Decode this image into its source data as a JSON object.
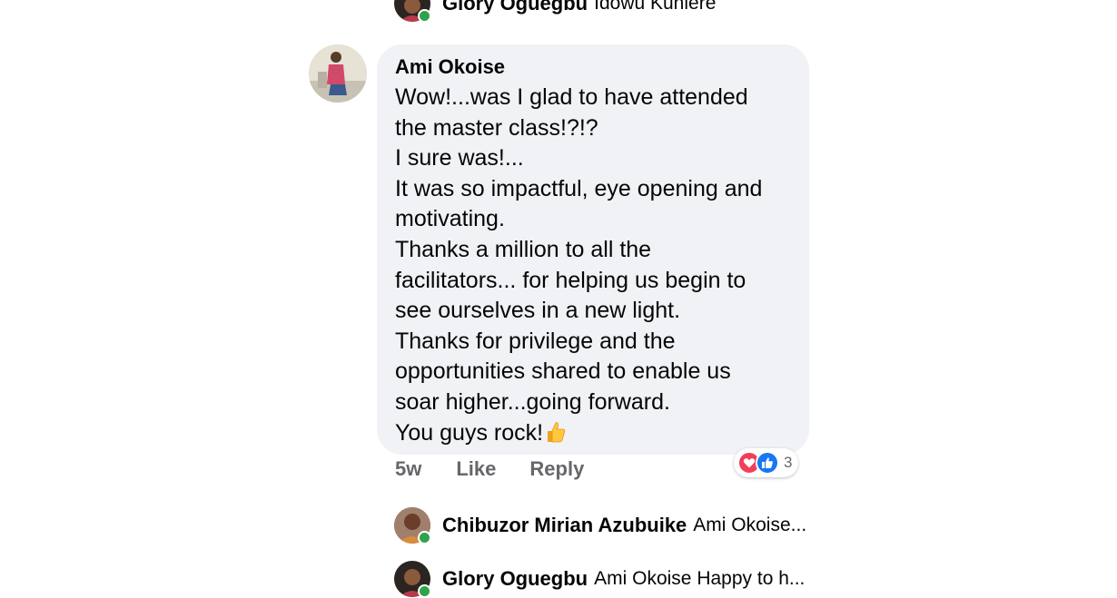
{
  "top_reply": {
    "name": "Glory Oguegbu",
    "text": "Idowu Kuniere"
  },
  "comment": {
    "author": "Ami Okoise",
    "lines": [
      "Wow!...was I glad to have attended",
      "the master class!?!?",
      "I sure was!...",
      "It was so impactful, eye opening and",
      "motivating.",
      "Thanks a million to all the",
      "facilitators... for helping us begin to",
      "see ourselves in a new light.",
      "Thanks for privilege and the",
      "opportunities shared to enable us",
      "soar higher...going forward.",
      "You guys rock!"
    ],
    "time": "5w",
    "like_label": "Like",
    "reply_label": "Reply",
    "reaction_count": "3",
    "reactions": [
      "heart-icon",
      "like-thumb-icon"
    ],
    "colors": {
      "love": "#f33e58",
      "like": "#1877f2"
    }
  },
  "replies": [
    {
      "name": "Chibuzor Mirian Azubuike",
      "text": "Ami Okoise..."
    },
    {
      "name": "Glory Oguegbu",
      "text": "Ami Okoise Happy to h..."
    }
  ]
}
